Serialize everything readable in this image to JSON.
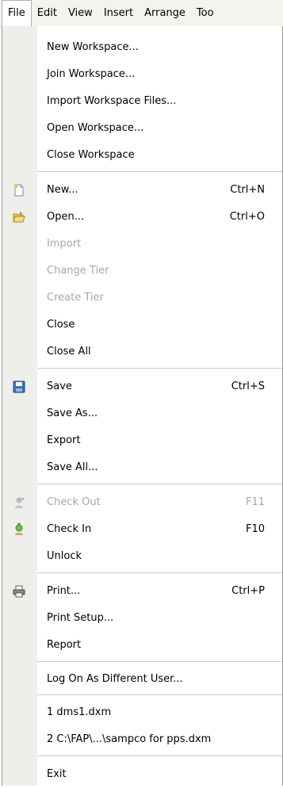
{
  "menubar": {
    "items": [
      "File",
      "Edit",
      "View",
      "Insert",
      "Arrange",
      "Too"
    ]
  },
  "file_menu": {
    "workspace": {
      "new": "New Workspace...",
      "join": "Join Workspace...",
      "import_files": "Import Workspace Files...",
      "open": "Open Workspace...",
      "close": "Close Workspace"
    },
    "document": {
      "new": "New...",
      "new_shortcut": "Ctrl+N",
      "open": "Open...",
      "open_shortcut": "Ctrl+O",
      "import": "Import",
      "change_tier": "Change Tier",
      "create_tier": "Create Tier",
      "close": "Close",
      "close_all": "Close All"
    },
    "save": {
      "save": "Save",
      "save_shortcut": "Ctrl+S",
      "save_as": "Save As...",
      "export": "Export",
      "save_all": "Save All..."
    },
    "checkout": {
      "check_out": "Check Out",
      "check_out_shortcut": "F11",
      "check_in": "Check In",
      "check_in_shortcut": "F10",
      "unlock": "Unlock"
    },
    "print": {
      "print": "Print...",
      "print_shortcut": "Ctrl+P",
      "print_setup": "Print Setup...",
      "report": "Report"
    },
    "logon": "Log On As Different User...",
    "recent": [
      "1 dms1.dxm",
      "2 C:\\FAP\\...\\sampco for pps.dxm"
    ],
    "exit": "Exit"
  }
}
